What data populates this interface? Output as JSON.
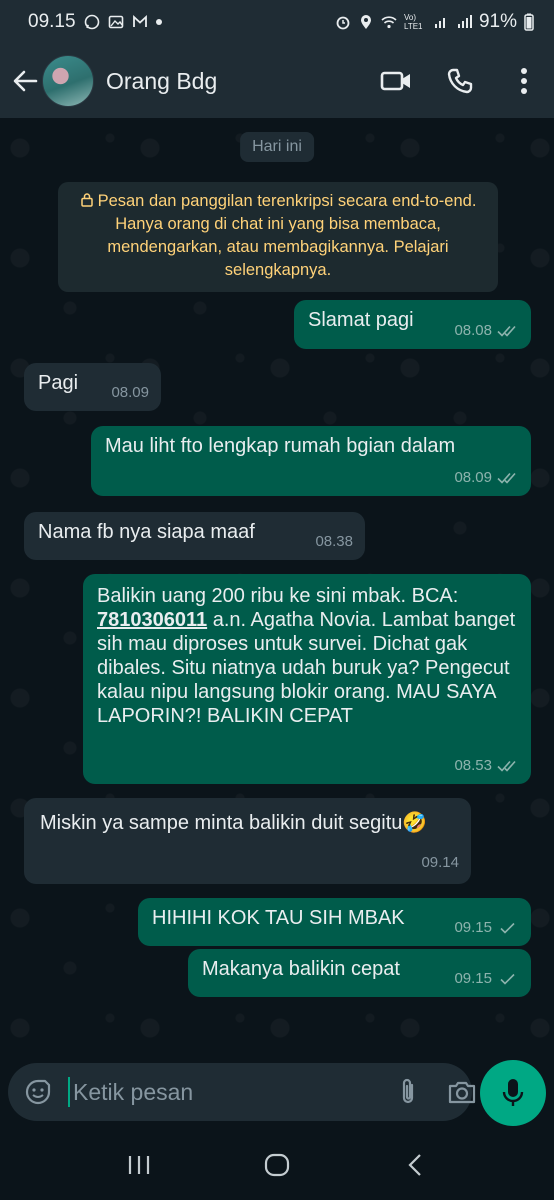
{
  "status_bar": {
    "time": "09.15",
    "battery": "91%",
    "network_label": "Vo) LTE1"
  },
  "header": {
    "contact_name": "Orang Bdg",
    "back_icon": "arrow-left-icon",
    "video_icon": "video-call-icon",
    "call_icon": "phone-icon",
    "menu_icon": "more-vertical-icon"
  },
  "chat": {
    "date_chip": "Hari ini",
    "encryption_notice": "Pesan dan panggilan terenkripsi secara end-to-end. Hanya orang di chat ini yang bisa membaca, mendengarkan, atau membagikannya. Pelajari selengkapnya.",
    "messages": [
      {
        "direction": "out",
        "text": "Slamat pagi",
        "time": "08.08",
        "status": "read"
      },
      {
        "direction": "in",
        "text": "Pagi",
        "time": "08.09"
      },
      {
        "direction": "out",
        "text": "Mau liht fto lengkap rumah bgian dalam",
        "time": "08.09",
        "status": "read"
      },
      {
        "direction": "in",
        "text": "Nama fb nya siapa maaf",
        "time": "08.38"
      },
      {
        "direction": "out",
        "text_before": "Balikin uang 200 ribu ke sini mbak. BCA: ",
        "account_number": "7810306011",
        "text_after": " a.n. Agatha Novia. Lambat banget sih mau diproses untuk survei. Dichat gak dibales. Situ niatnya udah buruk ya? Pengecut kalau nipu langsung blokir orang. MAU SAYA LAPORIN?! BALIKIN CEPAT",
        "time": "08.53",
        "status": "read"
      },
      {
        "direction": "in",
        "text": "Miskin ya sampe minta balikin duit segitu",
        "emoji": "🤣",
        "time": "09.14"
      },
      {
        "direction": "out",
        "text": "HIHIHI KOK TAU SIH MBAK",
        "time": "09.15",
        "status": "sent"
      },
      {
        "direction": "out",
        "text": "Makanya balikin cepat",
        "time": "09.15",
        "status": "sent"
      }
    ]
  },
  "input": {
    "placeholder": "Ketik pesan",
    "emoji_icon": "emoji-icon",
    "attach_icon": "paperclip-icon",
    "camera_icon": "camera-icon",
    "mic_icon": "mic-icon"
  },
  "colors": {
    "outgoing_bubble": "#005c4b",
    "incoming_bubble": "#1f2c34",
    "accent": "#00a884",
    "notice_text": "#ffd279"
  }
}
